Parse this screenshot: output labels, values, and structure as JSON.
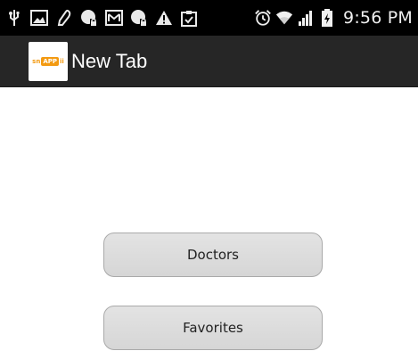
{
  "status_bar": {
    "time": "9:56 PM",
    "left_icons": [
      "usb-icon",
      "image-icon",
      "pen-icon",
      "locked-download-icon",
      "mail-icon",
      "locked-download-icon",
      "warning-icon",
      "clipboard-check-icon"
    ],
    "right_icons": [
      "alarm-icon",
      "wifi-icon",
      "signal-icon",
      "battery-charging-icon"
    ]
  },
  "action_bar": {
    "app_icon": "snappii-logo",
    "logo_text_left": "sn",
    "logo_text_badge": "APP",
    "logo_text_right": "ii",
    "title": "New Tab"
  },
  "main": {
    "buttons": [
      {
        "label": "Doctors"
      },
      {
        "label": "Favorites"
      }
    ]
  },
  "colors": {
    "status_bar_bg": "#000000",
    "action_bar_bg": "#262626",
    "button_bg": "#dcdcdc",
    "logo_accent": "#f39a12"
  }
}
